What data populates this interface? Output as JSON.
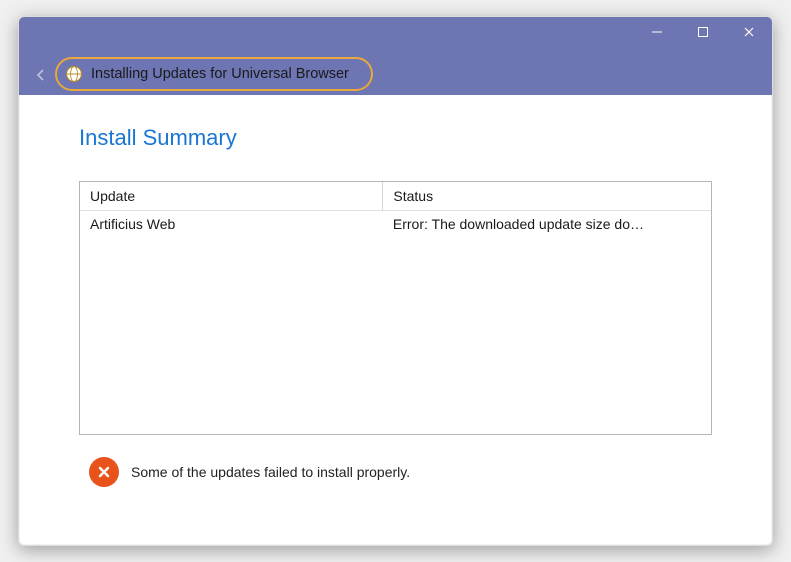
{
  "window": {
    "title": "Installing Updates for Universal Browser"
  },
  "heading": "Install Summary",
  "table": {
    "columns": [
      "Update",
      "Status"
    ],
    "rows": [
      {
        "name": "Artificius Web",
        "status": "Error: The downloaded update size do…"
      }
    ]
  },
  "footer": {
    "message": "Some of the updates failed to install properly."
  }
}
